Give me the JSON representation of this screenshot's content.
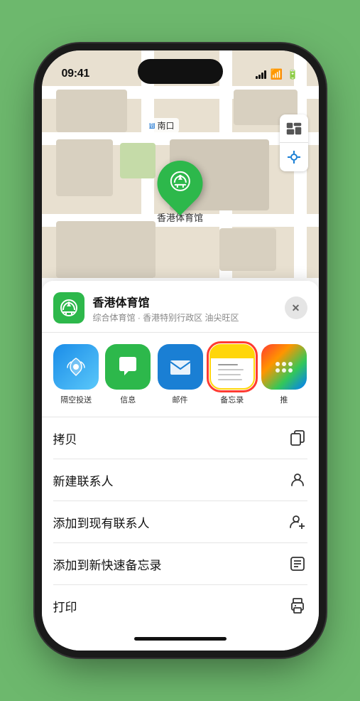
{
  "status_bar": {
    "time": "09:41",
    "location_arrow": "▲"
  },
  "map": {
    "label": "南口",
    "pin_label": "香港体育馆"
  },
  "sheet": {
    "title": "香港体育馆",
    "subtitle": "综合体育馆 · 香港特别行政区 油尖旺区",
    "close_label": "✕"
  },
  "apps": [
    {
      "id": "airdrop",
      "label": "隔空投送"
    },
    {
      "id": "messages",
      "label": "信息"
    },
    {
      "id": "mail",
      "label": "邮件"
    },
    {
      "id": "notes",
      "label": "备忘录",
      "highlighted": true
    },
    {
      "id": "more",
      "label": "推"
    }
  ],
  "actions": [
    {
      "id": "copy",
      "label": "拷贝",
      "icon": "copy"
    },
    {
      "id": "new-contact",
      "label": "新建联系人",
      "icon": "person"
    },
    {
      "id": "add-contact",
      "label": "添加到现有联系人",
      "icon": "person-add"
    },
    {
      "id": "quick-note",
      "label": "添加到新快速备忘录",
      "icon": "note"
    },
    {
      "id": "print",
      "label": "打印",
      "icon": "print"
    }
  ]
}
